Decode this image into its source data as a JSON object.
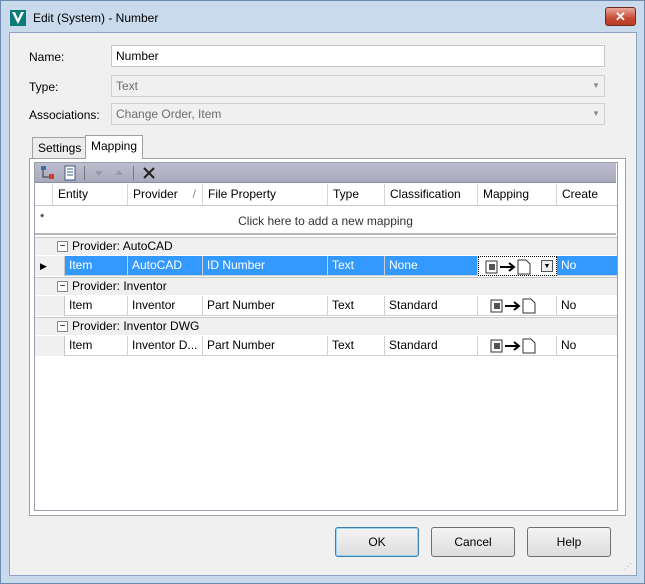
{
  "window": {
    "title": "Edit (System) - Number",
    "close_label": "✕"
  },
  "form": {
    "name_label": "Name:",
    "name_value": "Number",
    "type_label": "Type:",
    "type_value": "Text",
    "assoc_label": "Associations:",
    "assoc_value": "Change Order, Item"
  },
  "tabs": [
    {
      "label": "Settings"
    },
    {
      "label": "Mapping"
    }
  ],
  "grid": {
    "columns": [
      "Entity",
      "Provider",
      "File Property",
      "Type",
      "Classification",
      "Mapping",
      "Create"
    ],
    "sort_glyph": "/",
    "add_row_text": "Click here to add a new mapping",
    "add_row_star": "*",
    "groups": [
      {
        "label": "Provider: AutoCAD",
        "expander": "−",
        "row": {
          "entity": "Item",
          "provider": "AutoCAD",
          "file_property": "ID Number",
          "type": "Text",
          "classification": "None",
          "create": "No"
        }
      },
      {
        "label": "Provider: Inventor",
        "expander": "−",
        "row": {
          "entity": "Item",
          "provider": "Inventor",
          "file_property": "Part Number",
          "type": "Text",
          "classification": "Standard",
          "create": "No"
        }
      },
      {
        "label": "Provider: Inventor DWG",
        "expander": "−",
        "row": {
          "entity": "Item",
          "provider": "Inventor D...",
          "file_property": "Part Number",
          "type": "Text",
          "classification": "Standard",
          "create": "No"
        }
      }
    ],
    "selected_row_marker": "▶"
  },
  "buttons": {
    "ok": "OK",
    "cancel": "Cancel",
    "help": "Help"
  },
  "colors": {
    "selection": "#3399ff",
    "toolbar": "#b5b5c8",
    "brand": "#1fa3a3"
  }
}
